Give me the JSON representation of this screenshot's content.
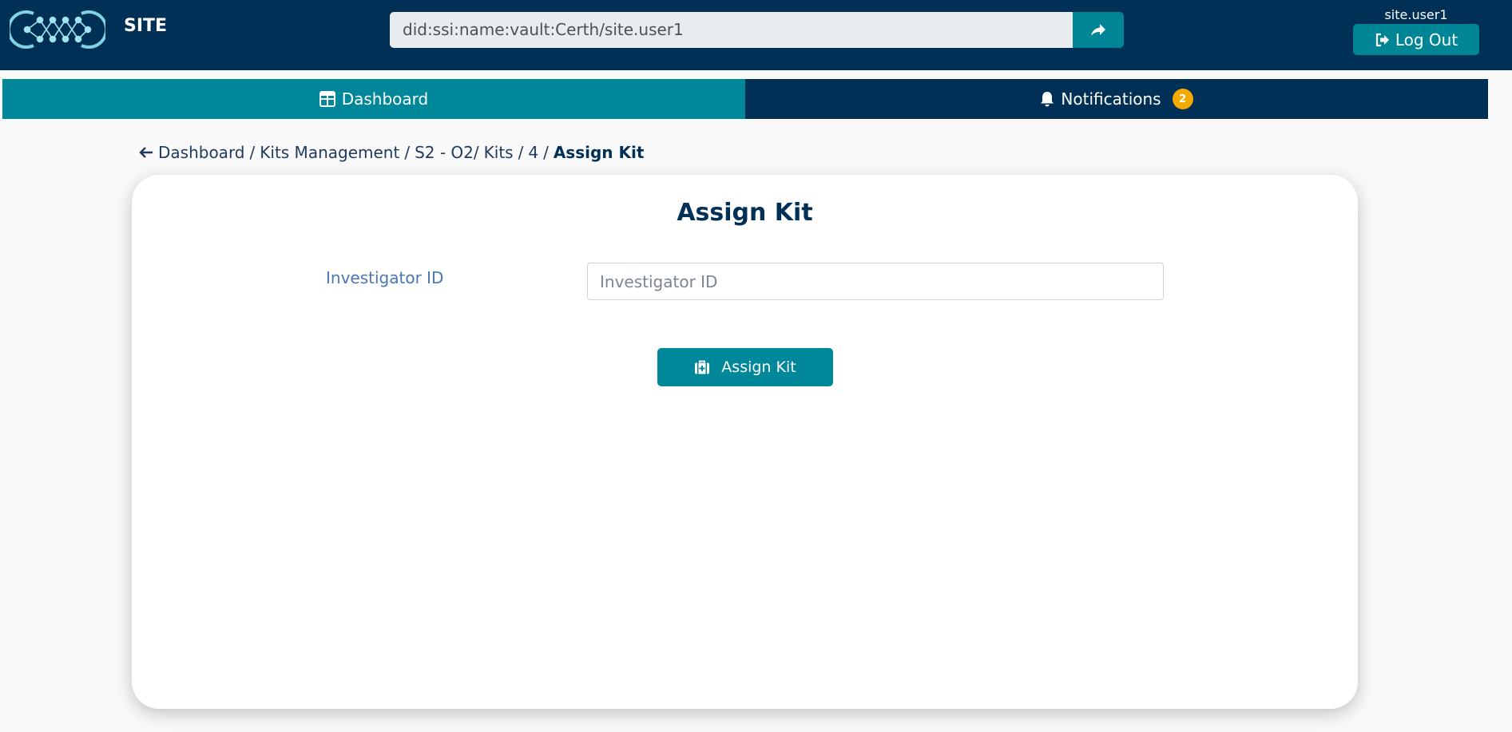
{
  "header": {
    "site_title": "SITE",
    "did_value": "did:ssi:name:vault:Certh/site.user1",
    "go_icon": "share-arrow-icon",
    "username": "site.user1",
    "logout_label": "Log Out",
    "logout_icon": "sign-out-icon"
  },
  "tabs": {
    "dashboard_label": "Dashboard",
    "dashboard_icon": "grid-icon",
    "notifications_label": "Notifications",
    "notifications_icon": "bell-icon",
    "notifications_count": "2"
  },
  "breadcrumb": {
    "back_icon": "arrow-left-icon",
    "items": [
      "Dashboard",
      "Kits Management",
      "S2 - O2",
      "Kits",
      "4"
    ],
    "current": "Assign Kit"
  },
  "form": {
    "title": "Assign Kit",
    "investigator_label": "Investigator ID",
    "investigator_placeholder": "Investigator ID",
    "investigator_value": "",
    "submit_label": "Assign Kit",
    "submit_icon": "medical-kit-icon"
  },
  "colors": {
    "primary_dark": "#003056",
    "accent_teal": "#00879a",
    "badge": "#f2a900",
    "label_blue": "#4a77b4"
  }
}
